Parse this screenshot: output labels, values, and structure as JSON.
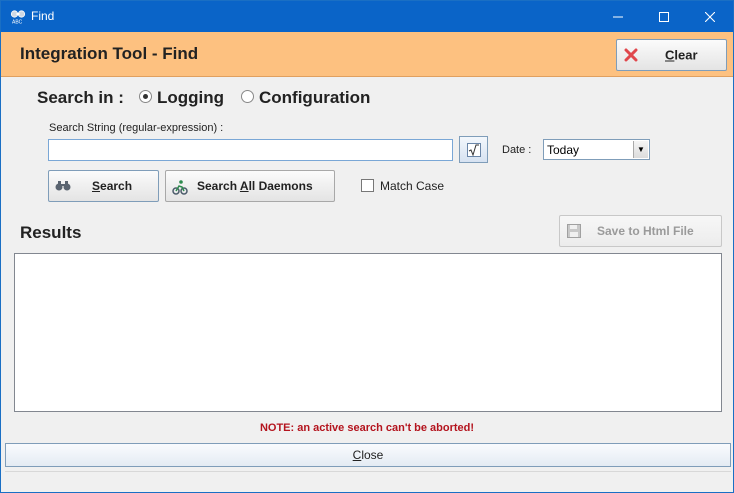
{
  "window": {
    "title": "Find"
  },
  "header": {
    "title": "Integration Tool - Find",
    "clear_prefix": "",
    "clear_ul": "C",
    "clear_rest": "lear"
  },
  "search_in": {
    "label": "Search in :",
    "options": [
      {
        "label": "Logging",
        "selected": true
      },
      {
        "label": "Configuration",
        "selected": false
      }
    ]
  },
  "search_string": {
    "label": "Search String (regular-expression) :",
    "value": ""
  },
  "date": {
    "label": "Date :",
    "selected": "Today"
  },
  "buttons": {
    "search_ul": "S",
    "search_rest": "earch",
    "all_a": "Search ",
    "all_ul": "A",
    "all_rest": "ll Daemons",
    "save": "Save to Html File",
    "close_ul": "C",
    "close_rest": "lose"
  },
  "match_case": {
    "label": "Match Case",
    "checked": false
  },
  "results": {
    "title": "Results"
  },
  "note": "NOTE: an active search can't be aborted!",
  "colors": {
    "header_bg": "#fdc180",
    "titlebar": "#0a64c8",
    "note": "#b4141e"
  },
  "icons": [
    "binoculars-icon",
    "cyclist-icon",
    "floppy-disk-icon",
    "red-x-icon",
    "sqrt-icon"
  ]
}
